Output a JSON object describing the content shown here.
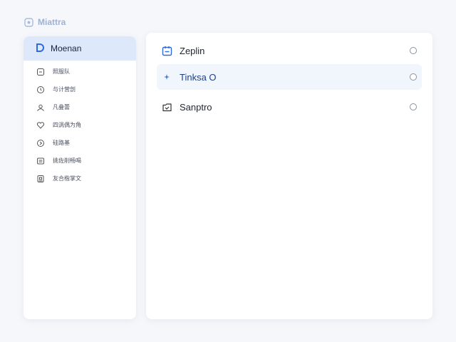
{
  "app": {
    "title": "Miattra"
  },
  "sidebar": {
    "header": {
      "label": "Moenan",
      "icon": "d-logo-icon"
    },
    "items": [
      {
        "label": "照服队",
        "icon": "doc-icon"
      },
      {
        "label": "与计营剖",
        "icon": "clock-icon"
      },
      {
        "label": "凡叠蕾",
        "icon": "users-icon"
      },
      {
        "label": "四涡偶为角",
        "icon": "heart-icon"
      },
      {
        "label": "硅路基",
        "icon": "play-icon"
      },
      {
        "label": "挑佐削畅喝",
        "icon": "card-icon"
      },
      {
        "label": "友合楷掌文",
        "icon": "building-icon"
      }
    ]
  },
  "main": {
    "options": [
      {
        "label": "Zeplin",
        "icon": "calendar-icon",
        "selected": false
      },
      {
        "label": "Tinksa O",
        "icon": "sparkle-icon",
        "selected": true
      },
      {
        "label": "Sanptro",
        "icon": "folder-icon",
        "selected": false
      }
    ]
  },
  "colors": {
    "accent": "#2f6bdc",
    "selected_bg": "#f1f5fc",
    "sidebar_head_bg": "#dde8fb",
    "page_bg": "#f5f7fb"
  }
}
